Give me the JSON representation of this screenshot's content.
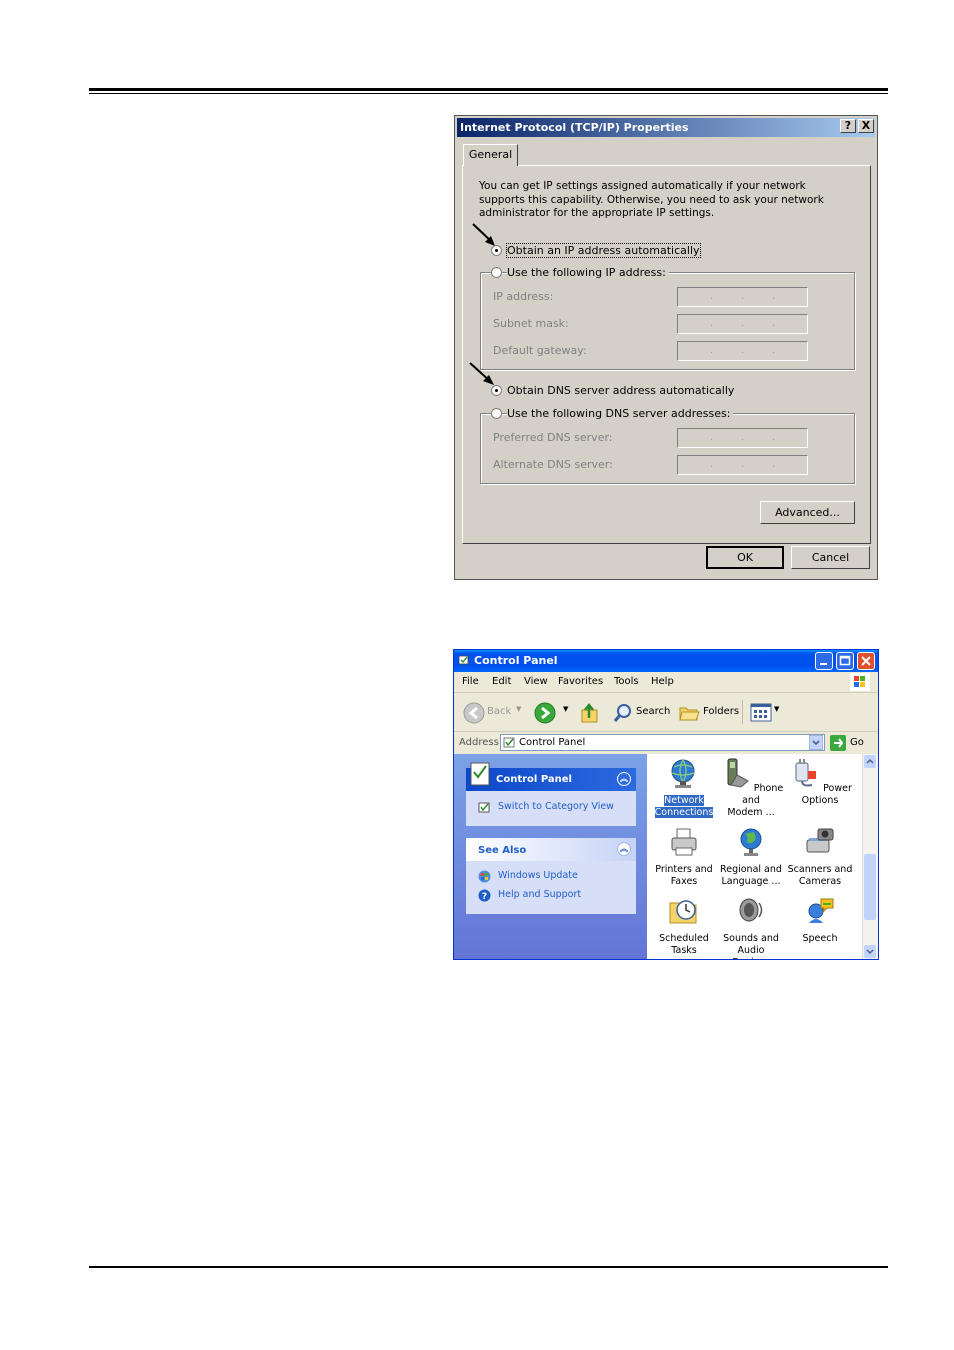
{
  "tcpip_dialog": {
    "title": "Internet Protocol (TCP/IP) Properties",
    "help_btn": "?",
    "close_btn": "X",
    "tab": "General",
    "description": "You can get IP settings assigned automatically if your network supports this capability. Otherwise, you need to ask your network administrator for the appropriate IP settings.",
    "radio_obtain_ip": "Obtain an IP address automatically",
    "radio_use_ip": "Use the following IP address:",
    "ip_address_label": "IP address:",
    "subnet_mask_label": "Subnet mask:",
    "default_gateway_label": "Default gateway:",
    "radio_obtain_dns": "Obtain DNS server address automatically",
    "radio_use_dns": "Use the following DNS server addresses:",
    "preferred_dns_label": "Preferred DNS server:",
    "alternate_dns_label": "Alternate DNS server:",
    "ip_dot": ".",
    "advanced_button": "Advanced...",
    "ok_button": "OK",
    "cancel_button": "Cancel",
    "selected": {
      "ip": "automatic",
      "dns": "automatic"
    }
  },
  "control_panel": {
    "title": "Control Panel",
    "menu": [
      "File",
      "Edit",
      "View",
      "Favorites",
      "Tools",
      "Help"
    ],
    "toolbar": {
      "back": "Back",
      "search": "Search",
      "folders": "Folders"
    },
    "address_label": "Address",
    "address_value": "Control Panel",
    "go_label": "Go",
    "sidebar": {
      "panel_title": "Control Panel",
      "switch_view": "Switch to Category View",
      "see_also_title": "See Also",
      "see_also_links": [
        "Windows Update",
        "Help and Support"
      ]
    },
    "items": [
      {
        "line1": "Network",
        "line2": "Connections",
        "selected": true,
        "icon": "network-globe-icon"
      },
      {
        "line1": "Phone and",
        "line2": "Modem ...",
        "icon": "phone-icon"
      },
      {
        "line1": "Power Options",
        "line2": "",
        "icon": "power-plug-icon"
      },
      {
        "line1": "Printers and",
        "line2": "Faxes",
        "icon": "printer-icon"
      },
      {
        "line1": "Regional and",
        "line2": "Language ...",
        "icon": "globe-icon"
      },
      {
        "line1": "Scanners and",
        "line2": "Cameras",
        "icon": "scanner-icon"
      },
      {
        "line1": "Scheduled",
        "line2": "Tasks",
        "icon": "clock-folder-icon"
      },
      {
        "line1": "Sounds and",
        "line2": "Audio Devices",
        "icon": "speaker-icon"
      },
      {
        "line1": "Speech",
        "line2": "",
        "icon": "speech-icon"
      }
    ]
  }
}
